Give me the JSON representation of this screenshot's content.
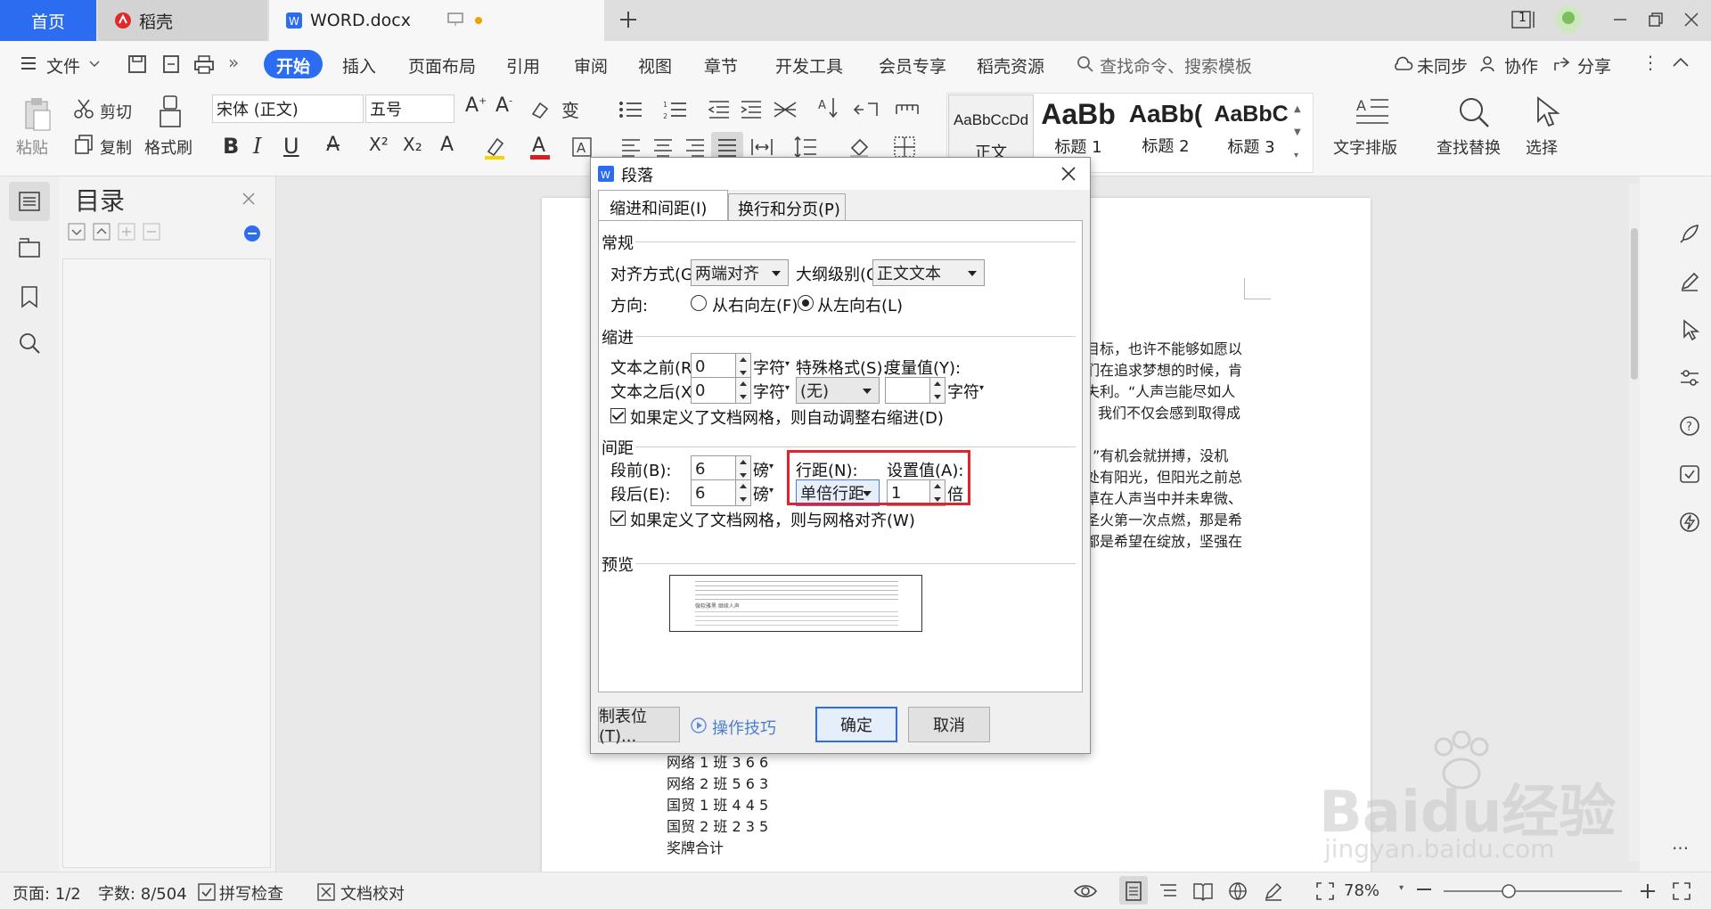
{
  "tabs": {
    "home": "首页",
    "daoke": "稻壳",
    "doc": "WORD.docx",
    "badge": "1"
  },
  "menu": {
    "file": "文件",
    "items": [
      "开始",
      "插入",
      "页面布局",
      "引用",
      "审阅",
      "视图",
      "章节",
      "开发工具",
      "会员专享",
      "稻壳资源"
    ],
    "search_placeholder": "查找命令、搜索模板",
    "sync": "未同步",
    "collab": "协作",
    "share": "分享"
  },
  "ribbon": {
    "paste": "粘贴",
    "cut": "剪切",
    "copy": "复制",
    "format_painter": "格式刷",
    "font": "宋体 (正文)",
    "size": "五号",
    "bold": "B",
    "italic": "I",
    "underline": "U",
    "styles": [
      {
        "preview": "AaBbCcDd",
        "name": "正文"
      },
      {
        "preview": "AaBb",
        "name": "标题 1"
      },
      {
        "preview": "AaBb(",
        "name": "标题 2"
      },
      {
        "preview": "AaBbC",
        "name": "标题 3"
      }
    ],
    "text_layout": "文字排版",
    "find_replace": "查找替换",
    "select": "选择"
  },
  "toc": {
    "title": "目录"
  },
  "doc_lines": {
    "right": [
      "目标，也许不能够如愿以",
      "们在追求梦想的时候，肯",
      "失利。“人声岂能尽如人",
      "我们不仅会感到取得成",
      "。”有机会就拼搏，没机",
      "处有阳光，但阳光之前总",
      "草在人声当中并未卑微、",
      "圣火第一次点燃，那是希",
      "都是希望在绽放，坚强在"
    ],
    "bottom": [
      "网络 1 班  3 6 6",
      "网络 2 班  5 6 3",
      "国贸 1 班  4 4 5",
      "国贸 2 班  2 3 5",
      "奖牌合计"
    ]
  },
  "dialog": {
    "title": "段落",
    "tab_indent": "缩进和间距(I)",
    "tab_break": "换行和分页(P)",
    "sec_general": "常规",
    "align_label": "对齐方式(G):",
    "align_value": "两端对齐",
    "outline_label": "大纲级别(O):",
    "outline_value": "正文文本",
    "direction_label": "方向:",
    "rtl": "从右向左(F)",
    "ltr": "从左向右(L)",
    "sec_indent": "缩进",
    "before_text_label": "文本之前(R):",
    "before_text_value": "0",
    "unit_char": "字符",
    "after_text_label": "文本之后(X):",
    "after_text_value": "0",
    "special_label": "特殊格式(S):",
    "special_value": "(无)",
    "measure_label": "度量值(Y):",
    "measure_value": "",
    "auto_indent_check": "如果定义了文档网格，则自动调整右缩进(D)",
    "sec_spacing": "间距",
    "before_label": "段前(B):",
    "before_value": "6",
    "unit_pound": "磅",
    "after_label": "段后(E):",
    "after_value": "6",
    "linespacing_label": "行距(N):",
    "linespacing_value": "单倍行距",
    "setvalue_label": "设置值(A):",
    "setvalue_value": "1",
    "unit_times": "倍",
    "grid_check": "如果定义了文档网格，则与网格对齐(W)",
    "sec_preview": "预览",
    "preview_text": "微软雅黑 继续人声",
    "tabs_button": "制表位(T)...",
    "tips": "操作技巧",
    "ok": "确定",
    "cancel": "取消"
  },
  "status": {
    "page": "页面: 1/2",
    "words": "字数: 8/504",
    "spell": "拼写检查",
    "proof": "文档校对",
    "zoom": "78%"
  },
  "watermark": {
    "brand": "Baidu经验",
    "url": "jingyan.baidu.com"
  },
  "colors": {
    "accent": "#2b6cf0",
    "highlight_box": "#e0232d"
  }
}
